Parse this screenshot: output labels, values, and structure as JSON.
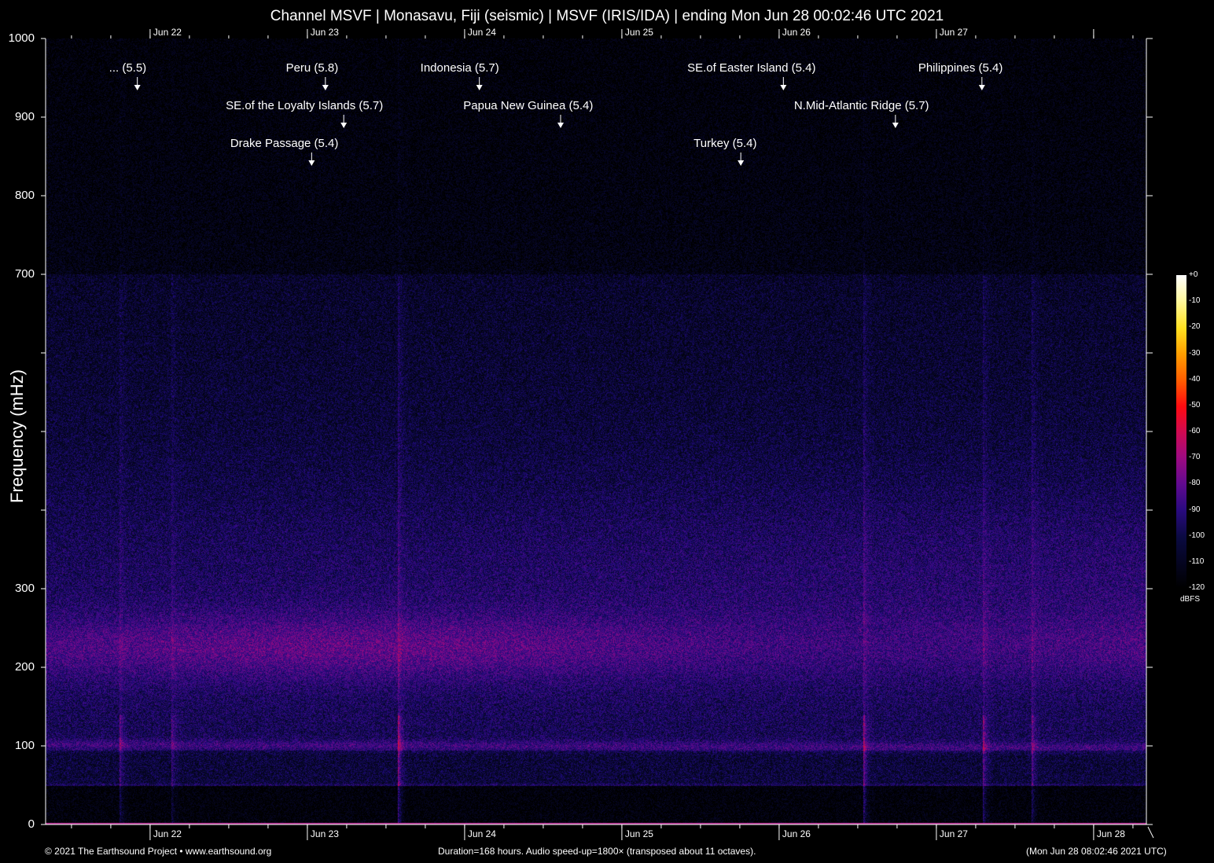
{
  "title": "Channel MSVF | Monasavu, Fiji (seismic) | MSVF (IRIS/IDA) | ending Mon Jun 28 00:02:46 UTC 2021",
  "chart_data": {
    "type": "heatmap",
    "title": "Channel MSVF | Monasavu, Fiji (seismic) | MSVF (IRIS/IDA) | ending Mon Jun 28 00:02:46 UTC 2021",
    "ylabel": "Frequency (mHz)",
    "ylim": [
      0,
      1000
    ],
    "yticks": [
      0,
      100,
      200,
      300,
      400,
      500,
      600,
      700,
      800,
      900,
      1000
    ],
    "ytick_labels": [
      "0",
      "100",
      "200",
      "300",
      "",
      "",
      "",
      "700",
      "800",
      "900",
      "1000"
    ],
    "xlim_hours": [
      0,
      168
    ],
    "x_day_ticks": [
      {
        "label": "Jun 22",
        "hour": 15.95
      },
      {
        "label": "Jun 23",
        "hour": 39.95
      },
      {
        "label": "Jun 24",
        "hour": 63.95
      },
      {
        "label": "Jun 25",
        "hour": 87.95
      },
      {
        "label": "Jun 26",
        "hour": 111.95
      },
      {
        "label": "Jun 27",
        "hour": 135.95
      },
      {
        "label": "Jun 28",
        "hour": 159.95
      }
    ],
    "events": [
      {
        "label": "... (5.5)",
        "hour": 14.0,
        "row": 1
      },
      {
        "label": "Peru (5.8)",
        "hour": 42.7,
        "row": 1
      },
      {
        "label": "Indonesia (5.7)",
        "hour": 66.2,
        "row": 1
      },
      {
        "label": "SE.of Easter Island (5.4)",
        "hour": 112.6,
        "row": 1
      },
      {
        "label": "Philippines (5.4)",
        "hour": 142.9,
        "row": 1
      },
      {
        "label": "SE.of the Loyalty Islands (5.7)",
        "hour": 45.5,
        "row": 2
      },
      {
        "label": "Papua New Guinea (5.4)",
        "hour": 78.6,
        "row": 2
      },
      {
        "label": "N.Mid-Atlantic Ridge (5.7)",
        "hour": 129.7,
        "row": 2
      },
      {
        "label": "Drake Passage (5.4)",
        "hour": 40.6,
        "row": 3
      },
      {
        "label": "Turkey (5.4)",
        "hour": 106.1,
        "row": 3
      }
    ],
    "colorbar": {
      "unit": "dBFS",
      "range": [
        -120,
        0
      ],
      "ticks": [
        "+0",
        "-10",
        "-20",
        "-30",
        "-40",
        "-50",
        "-60",
        "-70",
        "-80",
        "-90",
        "-100",
        "-110",
        "-120"
      ]
    }
  },
  "footer": {
    "left": "© 2021 The Earthsound Project • www.earthsound.org",
    "center": "Duration=168 hours. Audio speed-up=1800× (transposed about 11 octaves).",
    "right": "(Mon Jun 28 08:02:46 2021 UTC)"
  }
}
